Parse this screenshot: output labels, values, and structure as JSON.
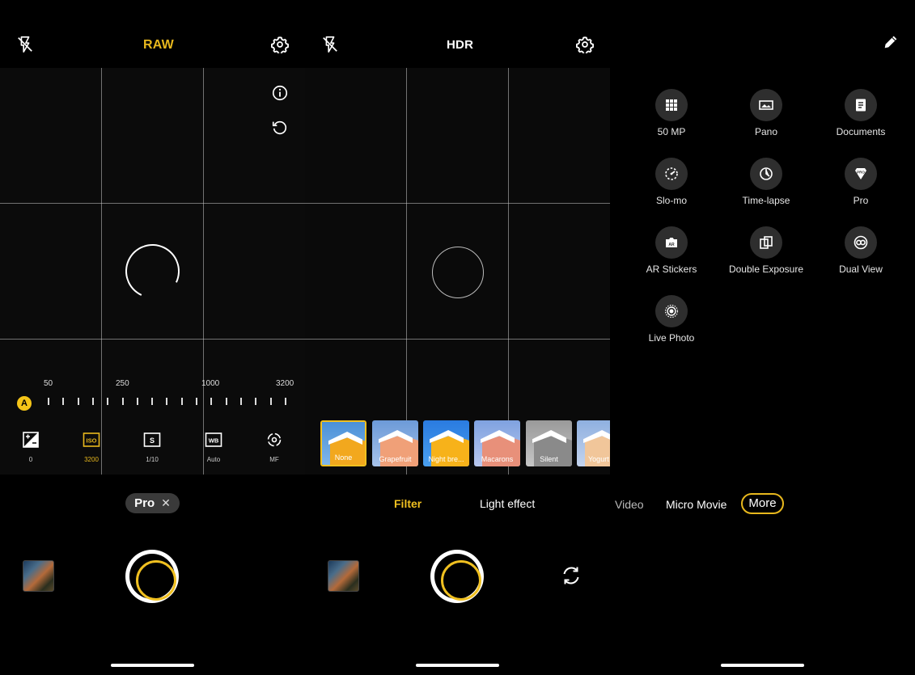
{
  "pro_screen": {
    "top_title": "RAW",
    "iso_scale": [
      "50",
      "250",
      "1000",
      "3200"
    ],
    "auto_badge": "A",
    "controls": [
      {
        "label": "0",
        "icon": "exposure-icon"
      },
      {
        "label": "3200",
        "icon": "iso-icon"
      },
      {
        "label": "1/10",
        "icon": "shutter-speed-icon"
      },
      {
        "label": "Auto",
        "icon": "white-balance-icon"
      },
      {
        "label": "MF",
        "icon": "focus-icon"
      }
    ],
    "mode_chip": "Pro",
    "chip_close": "✕"
  },
  "filter_screen": {
    "top_title": "HDR",
    "filters": [
      {
        "name": "None",
        "selected": true
      },
      {
        "name": "Grapefruit",
        "selected": false
      },
      {
        "name": "Night bre...",
        "selected": false
      },
      {
        "name": "Macarons",
        "selected": false
      },
      {
        "name": "Silent",
        "selected": false
      },
      {
        "name": "Yogurt",
        "selected": false
      }
    ],
    "tabs": [
      {
        "label": "Filter",
        "active": true
      },
      {
        "label": "Light effect",
        "active": false
      }
    ]
  },
  "more_screen": {
    "modes": [
      {
        "label": "50 MP",
        "icon": "grid-icon"
      },
      {
        "label": "Pano",
        "icon": "panorama-icon"
      },
      {
        "label": "Documents",
        "icon": "document-icon"
      },
      {
        "label": "Slo-mo",
        "icon": "slowmo-icon"
      },
      {
        "label": "Time-lapse",
        "icon": "timelapse-icon"
      },
      {
        "label": "Pro",
        "icon": "pro-icon"
      },
      {
        "label": "AR Stickers",
        "icon": "ar-stickers-icon"
      },
      {
        "label": "Double Exposure",
        "icon": "double-exposure-icon"
      },
      {
        "label": "Dual View",
        "icon": "dual-view-icon"
      },
      {
        "label": "Live Photo",
        "icon": "live-photo-icon"
      }
    ],
    "mode_strip": [
      "Video",
      "Micro Movie",
      "More"
    ]
  },
  "colors": {
    "accent": "#f0c020",
    "background": "#000000"
  }
}
